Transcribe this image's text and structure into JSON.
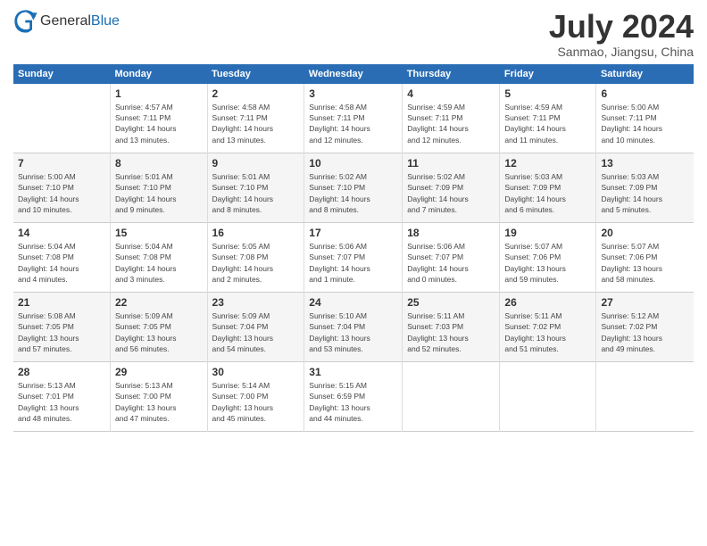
{
  "header": {
    "logo_general": "General",
    "logo_blue": "Blue",
    "month_year": "July 2024",
    "location": "Sanmao, Jiangsu, China"
  },
  "days_of_week": [
    "Sunday",
    "Monday",
    "Tuesday",
    "Wednesday",
    "Thursday",
    "Friday",
    "Saturday"
  ],
  "weeks": [
    [
      {
        "num": "",
        "info": ""
      },
      {
        "num": "1",
        "info": "Sunrise: 4:57 AM\nSunset: 7:11 PM\nDaylight: 14 hours\nand 13 minutes."
      },
      {
        "num": "2",
        "info": "Sunrise: 4:58 AM\nSunset: 7:11 PM\nDaylight: 14 hours\nand 13 minutes."
      },
      {
        "num": "3",
        "info": "Sunrise: 4:58 AM\nSunset: 7:11 PM\nDaylight: 14 hours\nand 12 minutes."
      },
      {
        "num": "4",
        "info": "Sunrise: 4:59 AM\nSunset: 7:11 PM\nDaylight: 14 hours\nand 12 minutes."
      },
      {
        "num": "5",
        "info": "Sunrise: 4:59 AM\nSunset: 7:11 PM\nDaylight: 14 hours\nand 11 minutes."
      },
      {
        "num": "6",
        "info": "Sunrise: 5:00 AM\nSunset: 7:11 PM\nDaylight: 14 hours\nand 10 minutes."
      }
    ],
    [
      {
        "num": "7",
        "info": "Sunrise: 5:00 AM\nSunset: 7:10 PM\nDaylight: 14 hours\nand 10 minutes."
      },
      {
        "num": "8",
        "info": "Sunrise: 5:01 AM\nSunset: 7:10 PM\nDaylight: 14 hours\nand 9 minutes."
      },
      {
        "num": "9",
        "info": "Sunrise: 5:01 AM\nSunset: 7:10 PM\nDaylight: 14 hours\nand 8 minutes."
      },
      {
        "num": "10",
        "info": "Sunrise: 5:02 AM\nSunset: 7:10 PM\nDaylight: 14 hours\nand 8 minutes."
      },
      {
        "num": "11",
        "info": "Sunrise: 5:02 AM\nSunset: 7:09 PM\nDaylight: 14 hours\nand 7 minutes."
      },
      {
        "num": "12",
        "info": "Sunrise: 5:03 AM\nSunset: 7:09 PM\nDaylight: 14 hours\nand 6 minutes."
      },
      {
        "num": "13",
        "info": "Sunrise: 5:03 AM\nSunset: 7:09 PM\nDaylight: 14 hours\nand 5 minutes."
      }
    ],
    [
      {
        "num": "14",
        "info": "Sunrise: 5:04 AM\nSunset: 7:08 PM\nDaylight: 14 hours\nand 4 minutes."
      },
      {
        "num": "15",
        "info": "Sunrise: 5:04 AM\nSunset: 7:08 PM\nDaylight: 14 hours\nand 3 minutes."
      },
      {
        "num": "16",
        "info": "Sunrise: 5:05 AM\nSunset: 7:08 PM\nDaylight: 14 hours\nand 2 minutes."
      },
      {
        "num": "17",
        "info": "Sunrise: 5:06 AM\nSunset: 7:07 PM\nDaylight: 14 hours\nand 1 minute."
      },
      {
        "num": "18",
        "info": "Sunrise: 5:06 AM\nSunset: 7:07 PM\nDaylight: 14 hours\nand 0 minutes."
      },
      {
        "num": "19",
        "info": "Sunrise: 5:07 AM\nSunset: 7:06 PM\nDaylight: 13 hours\nand 59 minutes."
      },
      {
        "num": "20",
        "info": "Sunrise: 5:07 AM\nSunset: 7:06 PM\nDaylight: 13 hours\nand 58 minutes."
      }
    ],
    [
      {
        "num": "21",
        "info": "Sunrise: 5:08 AM\nSunset: 7:05 PM\nDaylight: 13 hours\nand 57 minutes."
      },
      {
        "num": "22",
        "info": "Sunrise: 5:09 AM\nSunset: 7:05 PM\nDaylight: 13 hours\nand 56 minutes."
      },
      {
        "num": "23",
        "info": "Sunrise: 5:09 AM\nSunset: 7:04 PM\nDaylight: 13 hours\nand 54 minutes."
      },
      {
        "num": "24",
        "info": "Sunrise: 5:10 AM\nSunset: 7:04 PM\nDaylight: 13 hours\nand 53 minutes."
      },
      {
        "num": "25",
        "info": "Sunrise: 5:11 AM\nSunset: 7:03 PM\nDaylight: 13 hours\nand 52 minutes."
      },
      {
        "num": "26",
        "info": "Sunrise: 5:11 AM\nSunset: 7:02 PM\nDaylight: 13 hours\nand 51 minutes."
      },
      {
        "num": "27",
        "info": "Sunrise: 5:12 AM\nSunset: 7:02 PM\nDaylight: 13 hours\nand 49 minutes."
      }
    ],
    [
      {
        "num": "28",
        "info": "Sunrise: 5:13 AM\nSunset: 7:01 PM\nDaylight: 13 hours\nand 48 minutes."
      },
      {
        "num": "29",
        "info": "Sunrise: 5:13 AM\nSunset: 7:00 PM\nDaylight: 13 hours\nand 47 minutes."
      },
      {
        "num": "30",
        "info": "Sunrise: 5:14 AM\nSunset: 7:00 PM\nDaylight: 13 hours\nand 45 minutes."
      },
      {
        "num": "31",
        "info": "Sunrise: 5:15 AM\nSunset: 6:59 PM\nDaylight: 13 hours\nand 44 minutes."
      },
      {
        "num": "",
        "info": ""
      },
      {
        "num": "",
        "info": ""
      },
      {
        "num": "",
        "info": ""
      }
    ]
  ]
}
